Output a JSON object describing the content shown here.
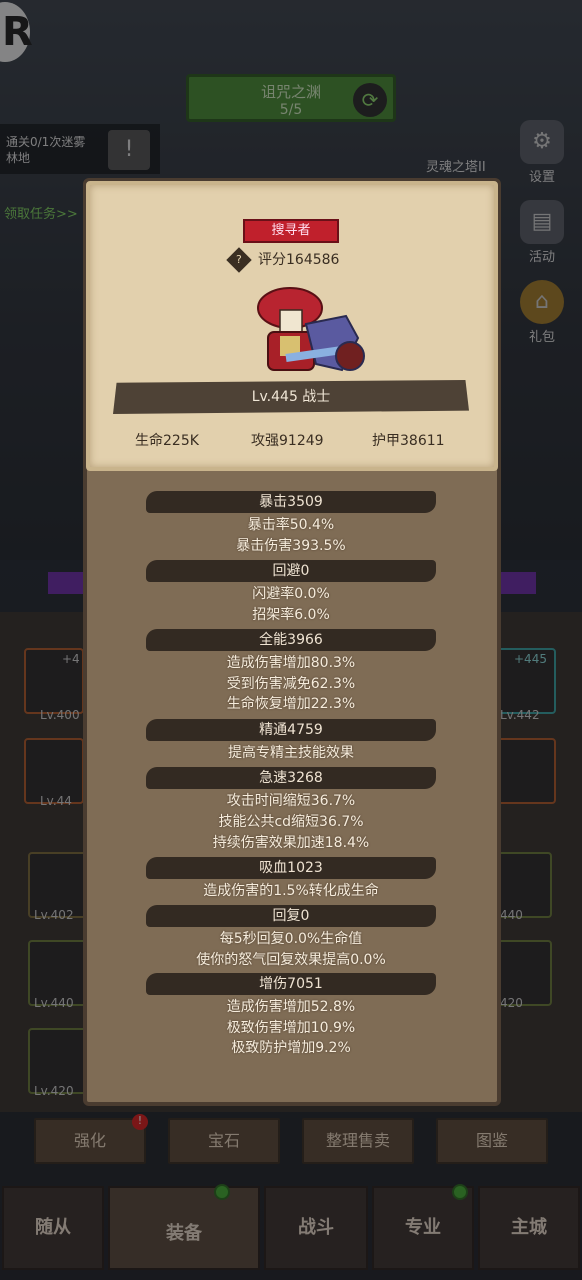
{
  "background": {
    "logo_letter": "R",
    "event": {
      "title": "诅咒之渊",
      "progress": "5/5"
    },
    "quest": {
      "text": "通关0/1次迷雾林地",
      "claim": "领取任务>>"
    },
    "tower_label": "灵魂之塔II",
    "side": [
      {
        "label": "设置",
        "icon": "gear-icon"
      },
      {
        "label": "活动",
        "icon": "scroll-icon"
      },
      {
        "label": "礼包",
        "icon": "gift-icon"
      }
    ],
    "gear_slots_left": [
      "Lv.400",
      "Lv.44",
      "Lv.402",
      "Lv.440",
      "Lv.420"
    ],
    "gear_slots_right": [
      "+445",
      "Lv.442",
      "440",
      "420"
    ],
    "slot_plus_left": "+4",
    "bottom_buttons": [
      "强化",
      "宝石",
      "整理售卖",
      "图鉴"
    ],
    "nav": [
      "随从",
      "装备",
      "战斗",
      "专业",
      "主城"
    ]
  },
  "panel": {
    "role": "搜寻者",
    "score": "评分164586",
    "level_class": "Lv.445 战士",
    "stats": [
      "生命225K",
      "攻强91249",
      "护甲38611"
    ],
    "groups": [
      {
        "header": "暴击3509",
        "lines": [
          "暴击率50.4%",
          "暴击伤害393.5%"
        ]
      },
      {
        "header": "回避0",
        "lines": [
          "闪避率0.0%",
          "招架率6.0%"
        ]
      },
      {
        "header": "全能3966",
        "lines": [
          "造成伤害增加80.3%",
          "受到伤害减免62.3%",
          "生命恢复增加22.3%"
        ]
      },
      {
        "header": "精通4759",
        "lines": [
          "提高专精主技能效果"
        ]
      },
      {
        "header": "急速3268",
        "lines": [
          "攻击时间缩短36.7%",
          "技能公共cd缩短36.7%",
          "持续伤害效果加速18.4%"
        ]
      },
      {
        "header": "吸血1023",
        "lines": [
          "造成伤害的1.5%转化成生命"
        ]
      },
      {
        "header": "回复0",
        "lines": [
          "每5秒回复0.0%生命值",
          "使你的怒气回复效果提高0.0%"
        ]
      },
      {
        "header": "增伤7051",
        "lines": [
          "造成伤害增加52.8%",
          "极致伤害增加10.9%",
          "极致防护增加9.2%"
        ]
      }
    ]
  },
  "colors": {
    "panel_bg": "#7f6c55",
    "header_bg": "#332a22",
    "role_red": "#c0202c",
    "event_green": "#4a8a35"
  }
}
